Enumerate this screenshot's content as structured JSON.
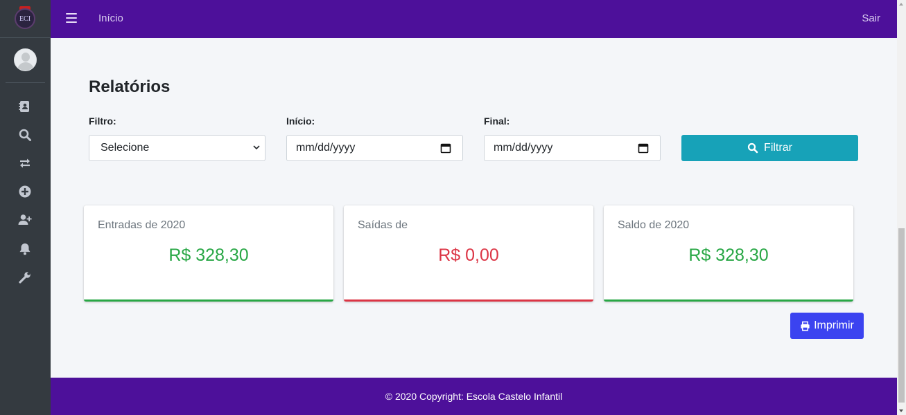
{
  "brand": {
    "logo_text": "ECI",
    "icon": "school-crest-logo"
  },
  "topbar": {
    "home_label": "Início",
    "exit_label": "Sair"
  },
  "sidebar": {
    "items": [
      {
        "icon": "address-book-icon"
      },
      {
        "icon": "search-icon"
      },
      {
        "icon": "exchange-icon"
      },
      {
        "icon": "plus-circle-icon"
      },
      {
        "icon": "user-plus-icon"
      },
      {
        "icon": "bell-icon"
      },
      {
        "icon": "wrench-icon"
      }
    ]
  },
  "page": {
    "title": "Relatórios"
  },
  "filters": {
    "filter_label": "Filtro:",
    "filter_value": "Selecione",
    "start_label": "Início:",
    "start_value": "mm/dd/yyyy",
    "end_label": "Final:",
    "end_value": "mm/dd/yyyy",
    "submit_label": "Filtrar"
  },
  "cards": [
    {
      "label": "Entradas de 2020",
      "value": "R$ 328,30",
      "color": "#28a745"
    },
    {
      "label": "Saídas de",
      "value": "R$ 0,00",
      "color": "#dc3545"
    },
    {
      "label": "Saldo de 2020",
      "value": "R$ 328,30",
      "color": "#28a745"
    }
  ],
  "print_label": "Imprimir",
  "footer": {
    "text": "© 2020 Copyright: Escola Castelo Infantil"
  },
  "colors": {
    "primary": "#4d109a",
    "info": "#17a2b8",
    "print": "#3b43f0",
    "sidebar": "#343a40"
  }
}
